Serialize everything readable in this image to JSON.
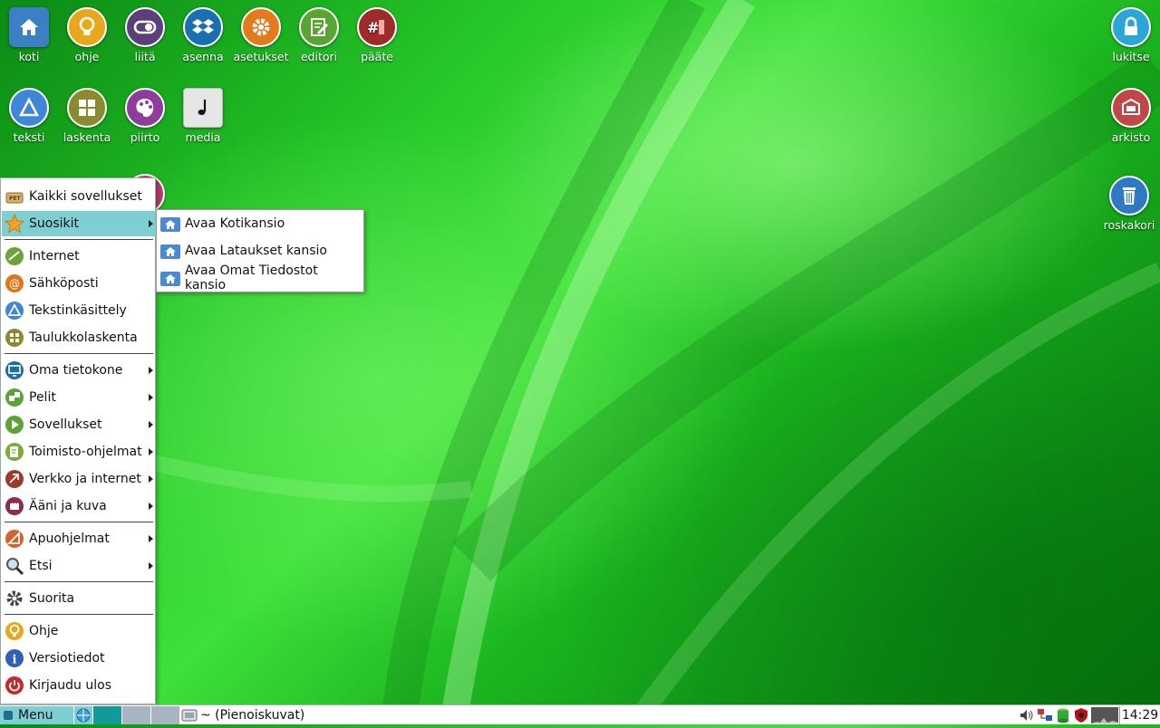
{
  "desktop": {
    "icons_left": [
      {
        "label": "koti",
        "icon": "home-folder-icon",
        "color": "#3b7fc4"
      },
      {
        "label": "ohje",
        "icon": "lightbulb-icon",
        "color": "#e8a81c"
      },
      {
        "label": "liitä",
        "icon": "toggle-icon",
        "color": "#5a3f7a"
      },
      {
        "label": "asenna",
        "icon": "dropbox-icon",
        "color": "#1a6fb0"
      },
      {
        "label": "asetukset",
        "icon": "gear-icon",
        "color": "#e47a1b"
      },
      {
        "label": "editori",
        "icon": "editor-icon",
        "color": "#5aa532"
      },
      {
        "label": "pääte",
        "icon": "terminal-icon",
        "color": "#9e2a2a"
      },
      {
        "label": "teksti",
        "icon": "text-icon",
        "color": "#3f86d8"
      },
      {
        "label": "laskenta",
        "icon": "calculator-icon",
        "color": "#8a8a2e"
      },
      {
        "label": "piirto",
        "icon": "palette-icon",
        "color": "#8e3d9c"
      },
      {
        "label": "media",
        "icon": "music-note-icon",
        "color": "#e6e6e6"
      }
    ],
    "icons_right": [
      {
        "label": "lukitse",
        "icon": "lock-icon",
        "color": "#2aa7d6"
      },
      {
        "label": "arkisto",
        "icon": "archive-icon",
        "color": "#c24747"
      },
      {
        "label": "roskakori",
        "icon": "trash-icon",
        "color": "#2f79c4"
      }
    ]
  },
  "menu": {
    "items": [
      {
        "label": "Kaikki sovellukset",
        "icon": "puppy-pet-icon",
        "submenu": false
      },
      {
        "label": "Suosikit",
        "icon": "star-icon",
        "submenu": true,
        "active": true
      },
      {
        "label": "Internet",
        "icon": "internet-icon",
        "submenu": false
      },
      {
        "label": "Sähköposti",
        "icon": "email-icon",
        "submenu": false
      },
      {
        "label": "Tekstinkäsittely",
        "icon": "text-icon",
        "submenu": false
      },
      {
        "label": "Taulukkolaskenta",
        "icon": "spreadsheet-icon",
        "submenu": false
      },
      {
        "label": "Oma tietokone",
        "icon": "monitor-icon",
        "submenu": true
      },
      {
        "label": "Pelit",
        "icon": "dice-icon",
        "submenu": true
      },
      {
        "label": "Sovellukset",
        "icon": "play-icon",
        "submenu": true
      },
      {
        "label": "Toimisto-ohjelmat",
        "icon": "office-icon",
        "submenu": true
      },
      {
        "label": "Verkko ja internet",
        "icon": "network-icon",
        "submenu": true
      },
      {
        "label": "Ääni ja kuva",
        "icon": "media-icon",
        "submenu": true
      },
      {
        "label": "Apuohjelmat",
        "icon": "utilities-icon",
        "submenu": true
      },
      {
        "label": "Etsi",
        "icon": "search-icon",
        "submenu": true
      },
      {
        "label": "Suorita",
        "icon": "gear-icon",
        "submenu": false
      },
      {
        "label": "Ohje",
        "icon": "lightbulb-icon",
        "submenu": false
      },
      {
        "label": "Versiotiedot",
        "icon": "info-icon",
        "submenu": false
      },
      {
        "label": "Kirjaudu ulos",
        "icon": "power-icon",
        "submenu": false
      }
    ]
  },
  "submenu": {
    "items": [
      {
        "label": "Avaa Kotikansio",
        "icon": "home-folder-icon"
      },
      {
        "label": "Avaa Lataukset kansio",
        "icon": "home-folder-icon"
      },
      {
        "label": "Avaa Omat Tiedostot kansio",
        "icon": "home-folder-icon"
      }
    ]
  },
  "taskbar": {
    "menu_label": "Menu",
    "task_label": "~ (Pienoiskuvat)",
    "clock": "14:29",
    "tray": [
      "volume-icon",
      "network-status-icon",
      "storage-icon",
      "firewall-icon",
      "cpu-graph-icon"
    ]
  }
}
